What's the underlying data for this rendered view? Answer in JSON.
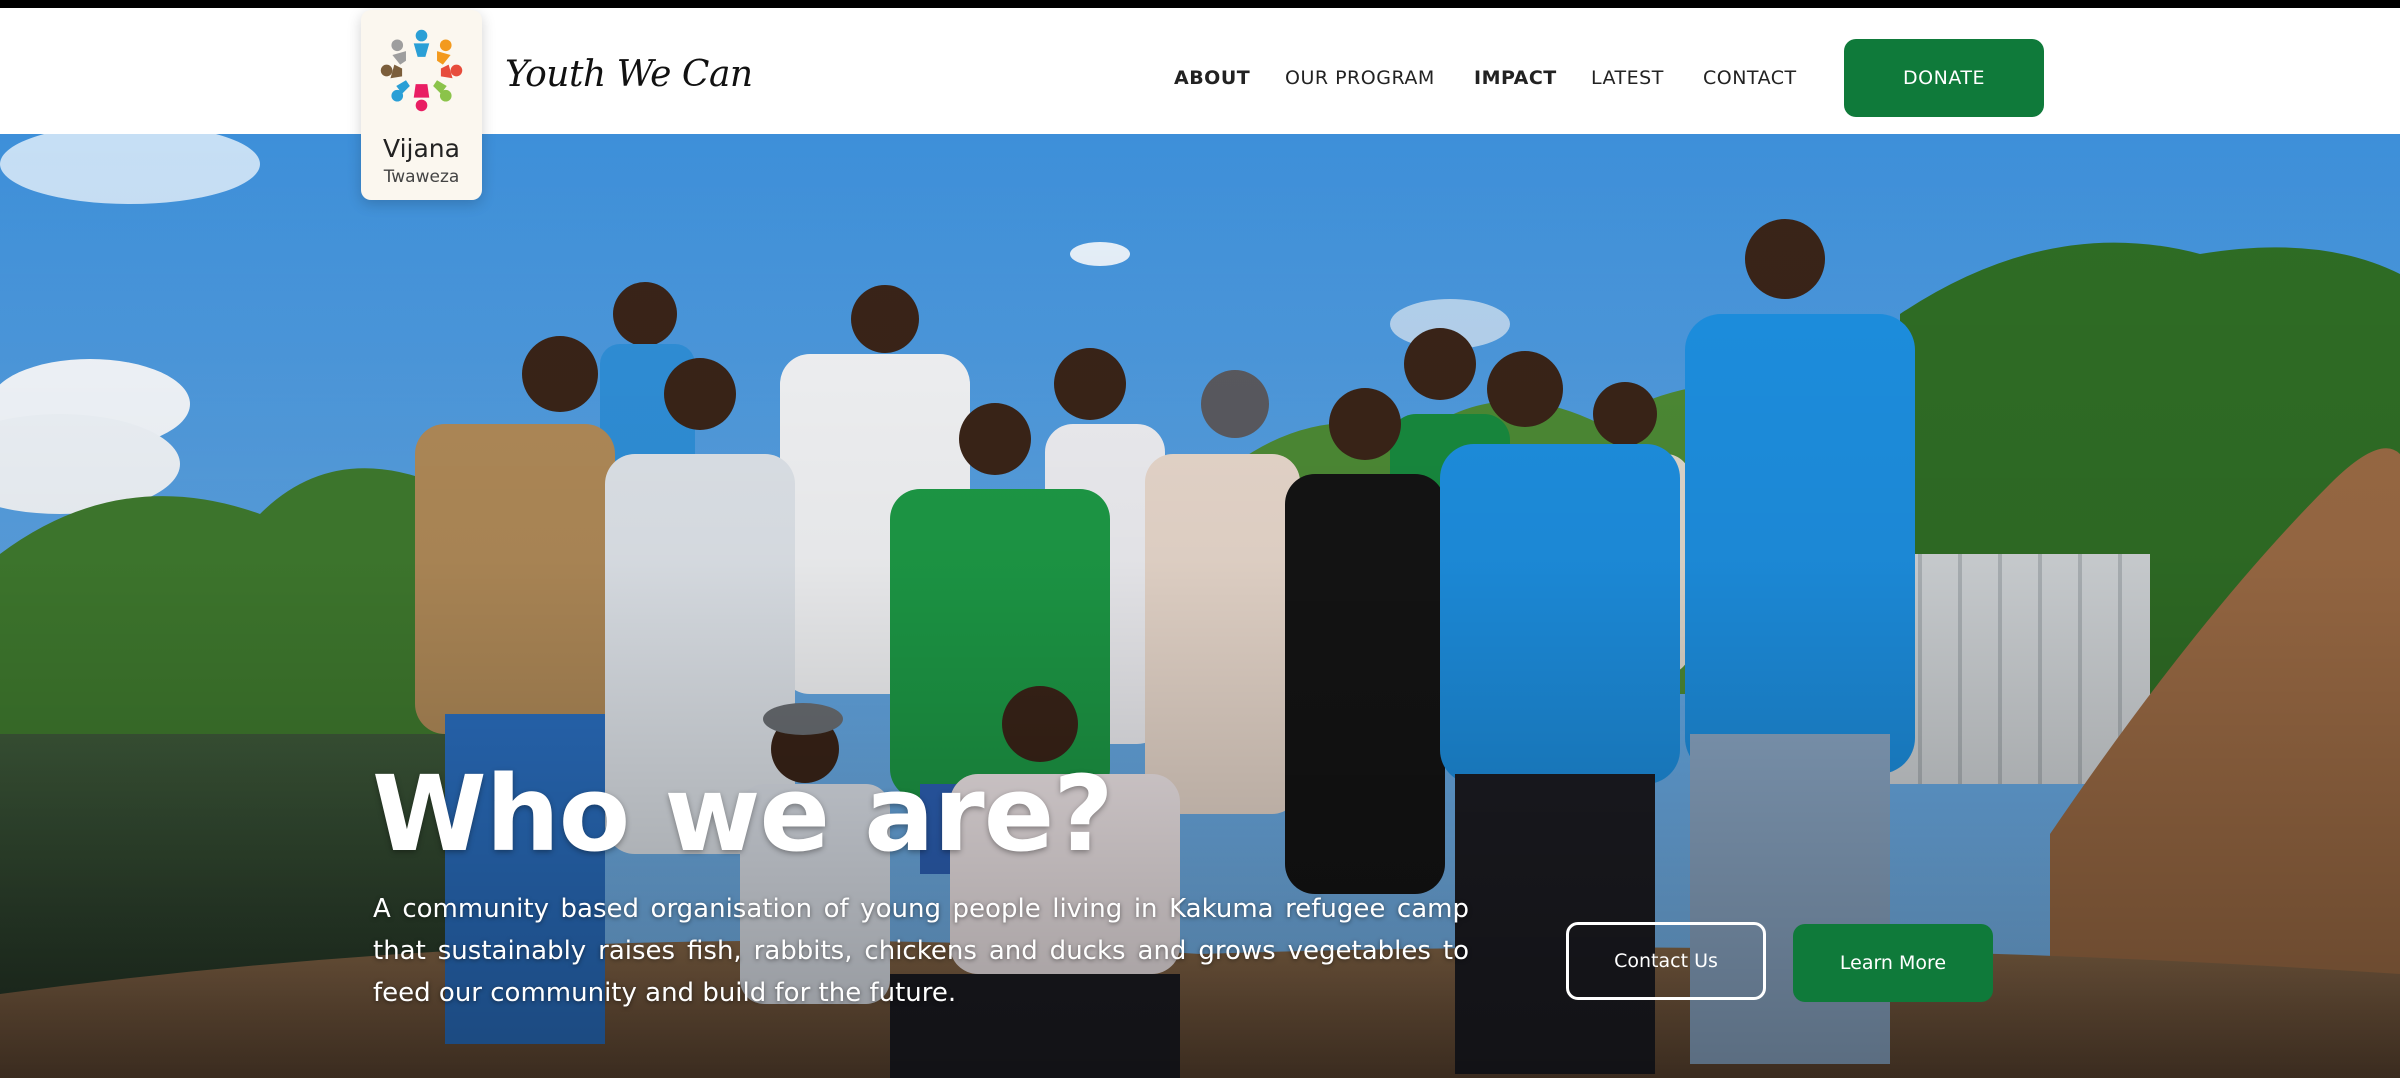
{
  "brand": {
    "logo_name": "Vijana",
    "logo_sub": "Twaweza",
    "tagline": "Youth We Can"
  },
  "nav": {
    "items": [
      {
        "label": "ABOUT"
      },
      {
        "label": "OUR PROGRAM"
      },
      {
        "label": "IMPACT"
      },
      {
        "label": "LATEST"
      },
      {
        "label": "CONTACT"
      }
    ],
    "donate_label": "DONATE"
  },
  "hero": {
    "title": "Who we are?",
    "description": "A community based organisation of young people living in Kakuma refugee camp that sustainably raises fish, rabbits, chickens and ducks and grows vegetables to feed our community and build for the future.",
    "contact_label": "Contact Us",
    "learn_label": "Learn More"
  },
  "colors": {
    "accent_green": "#0f7a3a",
    "text_dark": "#222222"
  }
}
